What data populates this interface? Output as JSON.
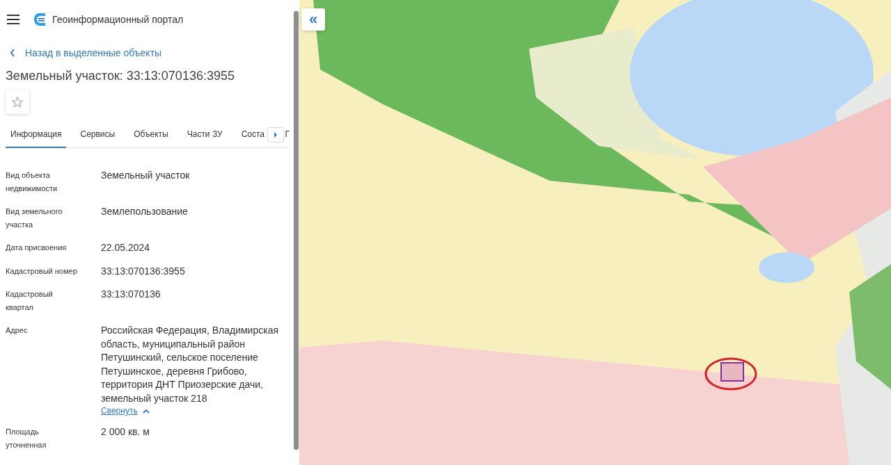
{
  "header": {
    "title": "Геоинформационный портал"
  },
  "back_link": "Назад в выделенные объекты",
  "object_title": "Земельный участок: 33:13:070136:3955",
  "favorite": {
    "on": false
  },
  "tabs": [
    {
      "label": "Информация",
      "selected": true
    },
    {
      "label": "Сервисы",
      "selected": false
    },
    {
      "label": "Объекты",
      "selected": false
    },
    {
      "label": "Части ЗУ",
      "selected": false
    },
    {
      "label": "Соста",
      "selected": false
    }
  ],
  "tabs_after_scroll": "Г",
  "fields": [
    {
      "label": "Вид объекта недвижимости",
      "value": "Земельный участок"
    },
    {
      "label": "Вид земельного участка",
      "value": "Землепользование"
    },
    {
      "label": "Дата присвоения",
      "value": "22.05.2024"
    },
    {
      "label": "Кадастровый номер",
      "value": "33:13:070136:3955"
    },
    {
      "label": "Кадастровый квартал",
      "value": "33:13:070136"
    },
    {
      "label": "Адрес",
      "value": "Российская Федерация, Владимирская область, муниципальный район Петушинский, сельское поселение Петушинское, деревня Грибово, территория ДНТ Приозерские дачи, земельный участок 218",
      "collapse_link": "Свернуть"
    },
    {
      "label": "Площадь уточненная",
      "value": "2 000 кв. м"
    }
  ],
  "map": {
    "kind": "picture",
    "collapse_button": "«"
  }
}
